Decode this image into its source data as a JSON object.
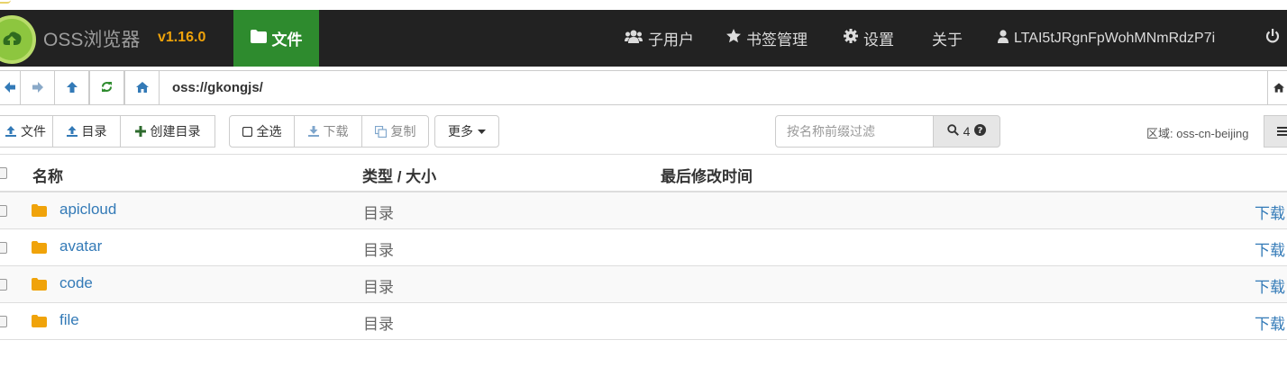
{
  "app": {
    "brand": "OSS浏览器",
    "version": "v1.16.0"
  },
  "nav": {
    "active_tab": "文件",
    "links": [
      {
        "label": "子用户",
        "icon": "users-icon"
      },
      {
        "label": "书签管理",
        "icon": "star-icon"
      },
      {
        "label": "设置",
        "icon": "gear-icon"
      },
      {
        "label": "关于",
        "icon": ""
      },
      {
        "label": "LTAI5tJRgnFpWohMNmRdzP7i",
        "icon": "user-icon"
      }
    ],
    "power_icon": "power-icon"
  },
  "address": {
    "path": "oss://gkongjs/",
    "buttons": [
      "back-icon",
      "forward-icon",
      "up-icon",
      "refresh-icon",
      "home-icon"
    ]
  },
  "toolbar": {
    "upload_file": "文件",
    "upload_dir": "目录",
    "create_dir": "创建目录",
    "select_all": "全选",
    "download": "下载",
    "copy": "复制",
    "more": "更多",
    "filter_placeholder": "按名称前缀过滤",
    "search_count": "4",
    "region": "区域: oss-cn-beijing"
  },
  "table": {
    "headers": {
      "name": "名称",
      "type_size": "类型 / 大小",
      "modified": "最后修改时间"
    },
    "rows": [
      {
        "name": "apicloud",
        "type": "目录",
        "action": "下载"
      },
      {
        "name": "avatar",
        "type": "目录",
        "action": "下载"
      },
      {
        "name": "code",
        "type": "目录",
        "action": "下载"
      },
      {
        "name": "file",
        "type": "目录",
        "action": "下载"
      }
    ]
  },
  "colors": {
    "navbar_bg": "#222222",
    "active_tab_bg": "#2e8b2e",
    "version_color": "#f0a30a",
    "link_color": "#337ab7",
    "folder_color": "#f0a30a"
  }
}
